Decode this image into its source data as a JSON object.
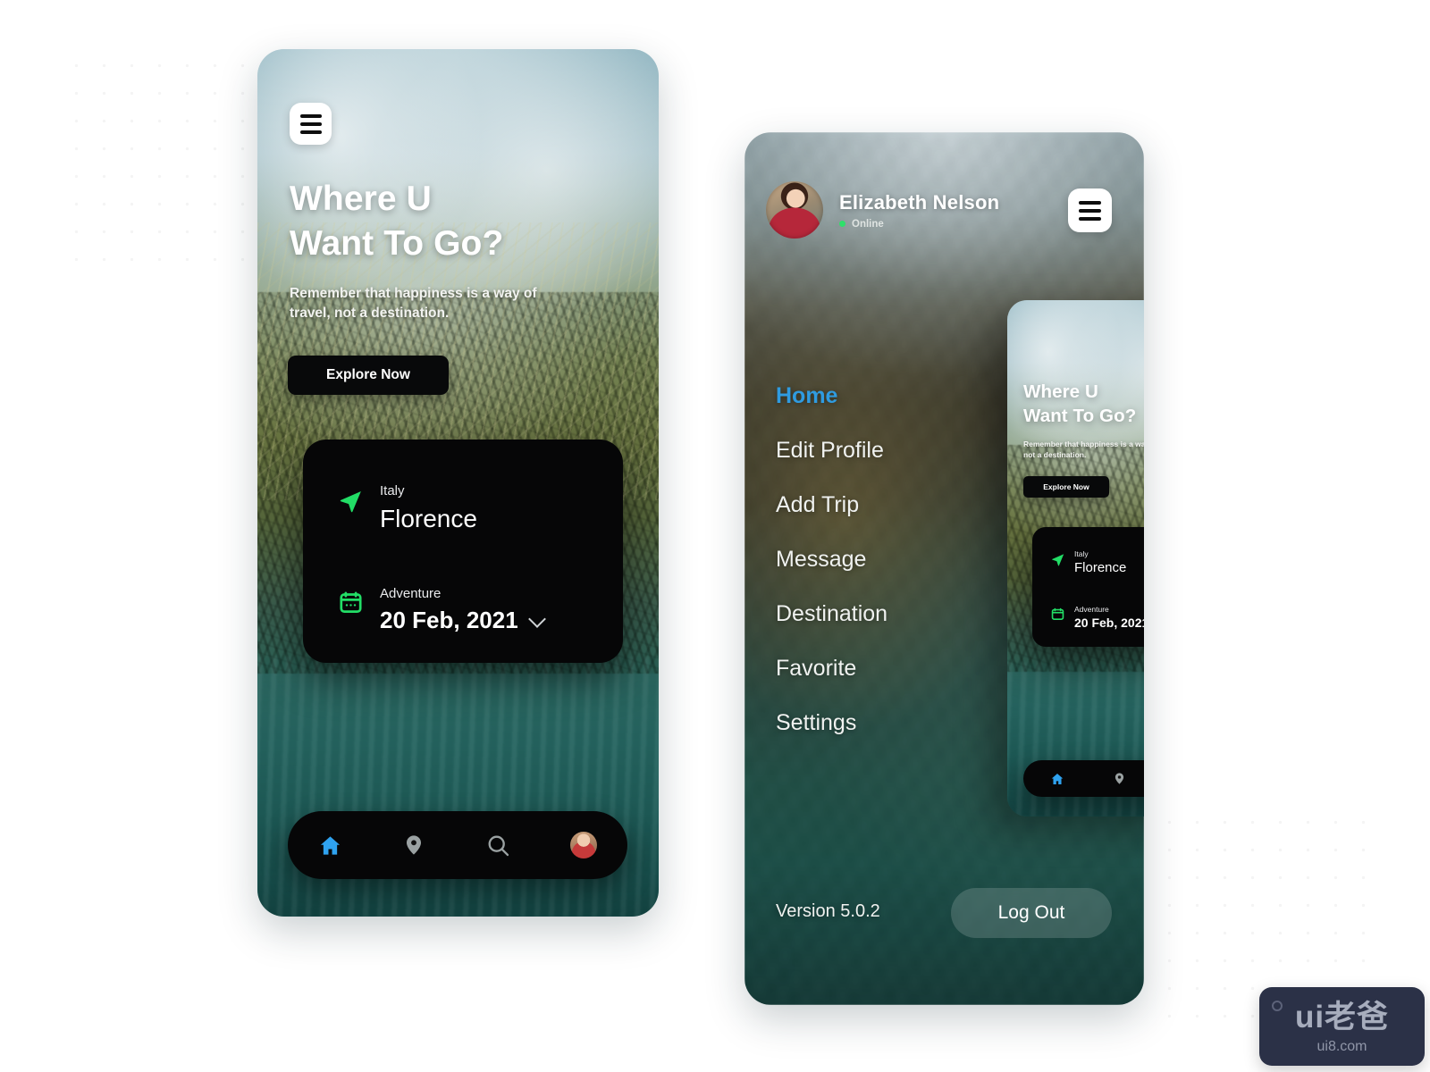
{
  "screen_home": {
    "menu_button_icon": "hamburger-icon",
    "hero": {
      "title_line1": "Where U",
      "title_line2": "Want To Go?",
      "subtitle": "Remember that happiness is a way of travel, not a destination.",
      "cta_label": "Explore Now"
    },
    "trip_card": {
      "location_icon": "navigation-arrow-icon",
      "country_label": "Italy",
      "city_value": "Florence",
      "date_icon": "calendar-icon",
      "trip_type_label": "Adventure",
      "date_value": "20 Feb, 2021",
      "date_dropdown_icon": "chevron-down-icon",
      "send_icon": "send-paper-plane-icon"
    },
    "bottom_nav": [
      {
        "name": "home",
        "icon": "home-icon",
        "active": true
      },
      {
        "name": "location",
        "icon": "map-pin-icon",
        "active": false
      },
      {
        "name": "search",
        "icon": "search-icon",
        "active": false
      },
      {
        "name": "profile",
        "icon": "avatar-icon",
        "active": false
      }
    ]
  },
  "screen_menu": {
    "profile": {
      "name": "Elizabeth Nelson",
      "status": "Online",
      "avatar_icon": "user-avatar-icon"
    },
    "menu_button_icon": "hamburger-icon",
    "items": [
      {
        "label": "Home",
        "active": true
      },
      {
        "label": "Edit Profile",
        "active": false
      },
      {
        "label": "Add Trip",
        "active": false
      },
      {
        "label": "Message",
        "active": false
      },
      {
        "label": "Destination",
        "active": false
      },
      {
        "label": "Favorite",
        "active": false
      },
      {
        "label": "Settings",
        "active": false
      }
    ],
    "version": "Version 5.0.2",
    "logout_label": "Log Out"
  },
  "watermark": {
    "main": "ui老爸",
    "sub": "ui8.com"
  },
  "colors": {
    "accent_blue": "#2FA2EF",
    "active_menu_blue": "#2F9BE0",
    "icon_green": "#2EE06A",
    "card_black": "#060607",
    "page_background": "#FFFFFF"
  }
}
